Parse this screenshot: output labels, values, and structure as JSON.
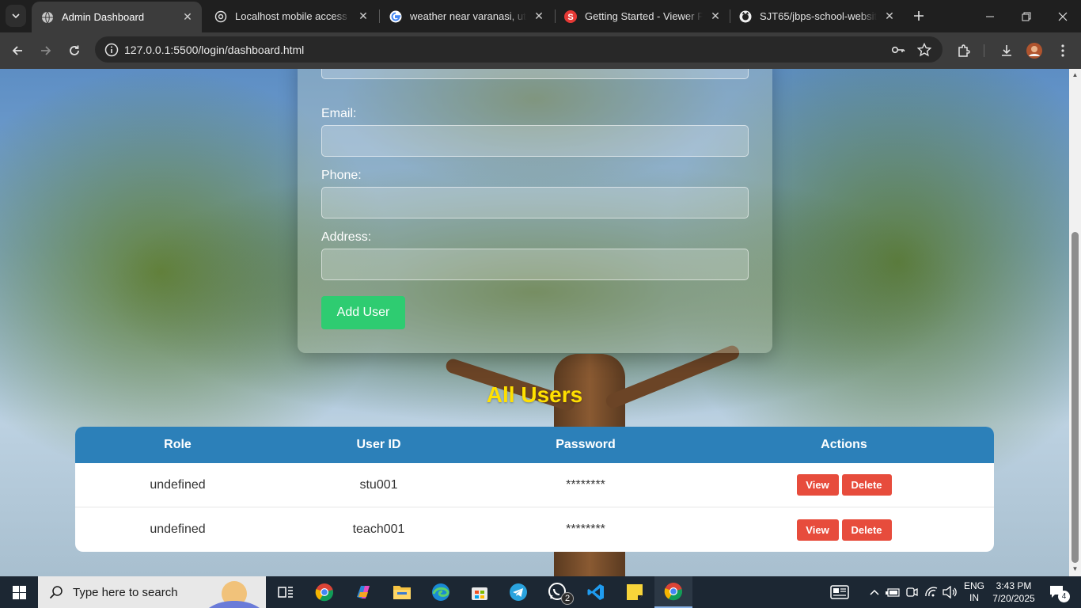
{
  "browser": {
    "tabs": [
      {
        "title": "Admin Dashboard",
        "active": true,
        "favicon": "globe-icon"
      },
      {
        "title": "Localhost mobile access solu",
        "active": false,
        "favicon": "openai-icon"
      },
      {
        "title": "weather near varanasi, uttar",
        "active": false,
        "favicon": "google-icon"
      },
      {
        "title": "Getting Started - Viewer Pag",
        "active": false,
        "favicon": "s-icon"
      },
      {
        "title": "SJT65/jbps-school-website-",
        "active": false,
        "favicon": "github-icon"
      }
    ],
    "url": "127.0.0.1:5500/login/dashboard.html"
  },
  "form": {
    "email_label": "Email:",
    "phone_label": "Phone:",
    "address_label": "Address:",
    "add_button": "Add User"
  },
  "users": {
    "heading": "All Users",
    "columns": [
      "Role",
      "User ID",
      "Password",
      "Actions"
    ],
    "rows": [
      {
        "role": "undefined",
        "user_id": "stu001",
        "password": "********",
        "view": "View",
        "delete": "Delete"
      },
      {
        "role": "undefined",
        "user_id": "teach001",
        "password": "********",
        "view": "View",
        "delete": "Delete"
      }
    ]
  },
  "taskbar": {
    "search_placeholder": "Type here to search",
    "whatsapp_badge": "2",
    "language": "ENG",
    "region": "IN",
    "time": "3:43 PM",
    "date": "7/20/2025",
    "notification_count": "4"
  },
  "colors": {
    "table_header": "#2c80b9",
    "add_button": "#2ecc71",
    "delete_button": "#e74c3c",
    "heading": "#ffe000"
  }
}
